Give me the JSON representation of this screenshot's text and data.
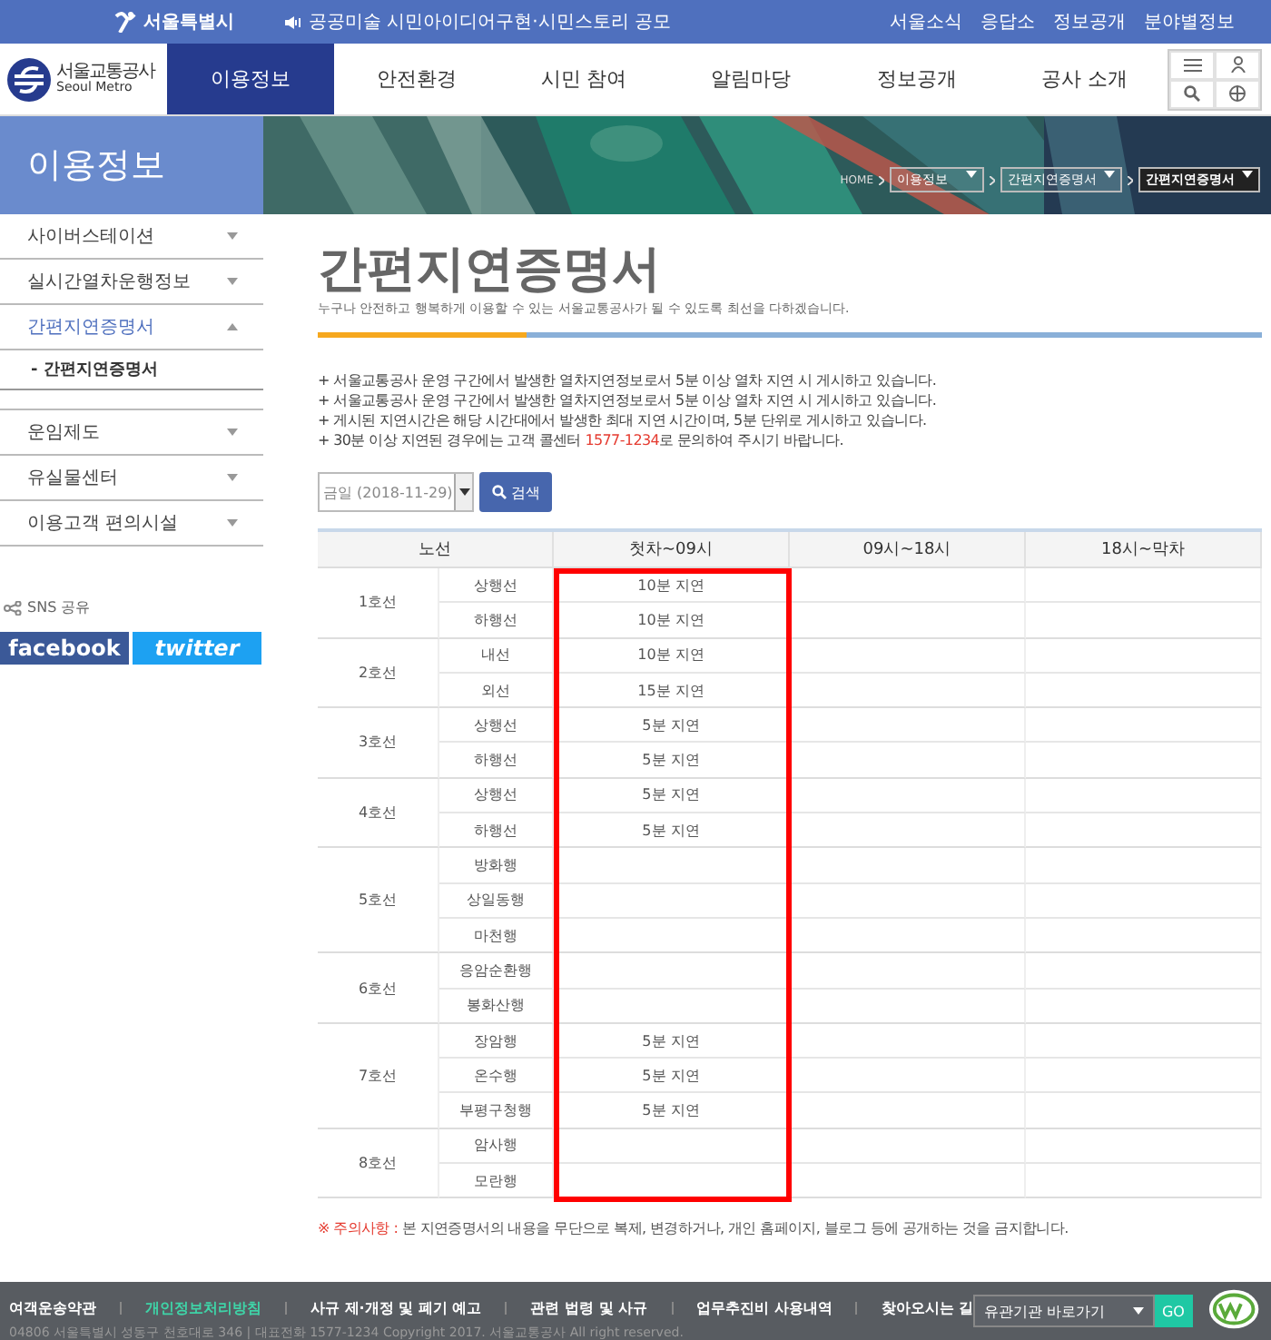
{
  "top_bar": {
    "city": "서울특별시",
    "notice": "공공미술 시민아이디어구현·시민스토리 공모",
    "links": [
      "서울소식",
      "응답소",
      "정보공개",
      "분야별정보"
    ]
  },
  "header": {
    "logo_ko": "서울교통공사",
    "logo_en": "Seoul Metro",
    "tabs": [
      {
        "label": "이용정보",
        "selected": true
      },
      {
        "label": "안전환경",
        "selected": false
      },
      {
        "label": "시민 참여",
        "selected": false
      },
      {
        "label": "알림마당",
        "selected": false
      },
      {
        "label": "정보공개",
        "selected": false
      },
      {
        "label": "공사 소개",
        "selected": false
      }
    ]
  },
  "banner": {
    "title": "이용정보",
    "home": "HOME",
    "breadcrumbs": [
      "이용정보",
      "간편지연증명서",
      "간편지연증명서"
    ]
  },
  "sidebar": {
    "items": [
      {
        "label": "사이버스테이션",
        "expanded": false,
        "selected": false
      },
      {
        "label": "실시간열차운행정보",
        "expanded": false,
        "selected": false
      },
      {
        "label": "간편지연증명서",
        "expanded": true,
        "selected": true,
        "children": [
          {
            "label": "- 간편지연증명서"
          }
        ]
      },
      {
        "label": "운임제도",
        "expanded": false,
        "selected": false
      },
      {
        "label": "유실물센터",
        "expanded": false,
        "selected": false
      },
      {
        "label": "이용고객 편의시설",
        "expanded": false,
        "selected": false
      }
    ],
    "share_label": "SNS 공유",
    "share_buttons": [
      "facebook",
      "twitter"
    ]
  },
  "page": {
    "title": "간편지연증명서",
    "subtitle": "누구나 안전하고 행복하게 이용할 수 있는 서울교통공사가 될 수 있도록 최선을 다하겠습니다.",
    "notes": [
      "+ 서울교통공사 운영 구간에서 발생한 열차지연정보로서 5분 이상 열차 지연 시 게시하고 있습니다.",
      "+ 서울교통공사 운영 구간에서 발생한 열차지연정보로서 5분 이상 열차 지연 시 게시하고 있습니다.",
      "+ 게시된 지연시간은 해당 시간대에서 발생한 최대 지연 시간이며, 5분 단위로 게시하고 있습니다.",
      "+ 30분 이상 지연된 경우에는 고객 콜센터 **1577-1234**로 문의하여 주시기 바랍니다."
    ],
    "date_select": "금일 (2018-11-29)",
    "search_button": "검색",
    "table": {
      "columns": [
        {
          "label": "노선",
          "highlighted": false
        },
        {
          "label": "첫차~09시",
          "highlighted": true
        },
        {
          "label": "09시~18시",
          "highlighted": false
        },
        {
          "label": "18시~막차",
          "highlighted": false
        }
      ],
      "lines": [
        {
          "name": "1호선",
          "directions": [
            {
              "name": "상행선",
              "delays": [
                "10분 지연"
              ]
            },
            {
              "name": "하행선",
              "delays": [
                "10분 지연"
              ]
            }
          ]
        },
        {
          "name": "2호선",
          "directions": [
            {
              "name": "내선",
              "delays": [
                "10분 지연"
              ]
            },
            {
              "name": "외선",
              "delays": [
                "15분 지연"
              ]
            }
          ]
        },
        {
          "name": "3호선",
          "directions": [
            {
              "name": "상행선",
              "delays": [
                "5분 지연"
              ]
            },
            {
              "name": "하행선",
              "delays": [
                "5분 지연"
              ]
            }
          ]
        },
        {
          "name": "4호선",
          "directions": [
            {
              "name": "상행선",
              "delays": [
                "5분 지연"
              ]
            },
            {
              "name": "하행선",
              "delays": [
                "5분 지연"
              ]
            }
          ]
        },
        {
          "name": "5호선",
          "directions": [
            {
              "name": "방화행"
            },
            {
              "name": "상일동행"
            },
            {
              "name": "마천행"
            }
          ]
        },
        {
          "name": "6호선",
          "directions": [
            {
              "name": "응암순환행"
            },
            {
              "name": "봉화산행"
            }
          ]
        },
        {
          "name": "7호선",
          "directions": [
            {
              "name": "장암행",
              "delays": [
                "5분 지연"
              ]
            },
            {
              "name": "온수행",
              "delays": [
                "5분 지연"
              ]
            },
            {
              "name": "부평구청행",
              "delays": [
                "5분 지연"
              ]
            }
          ]
        },
        {
          "name": "8호선",
          "directions": [
            {
              "name": "암사행"
            },
            {
              "name": "모란행"
            }
          ]
        }
      ]
    },
    "warning_label": "※ 주의사항 :",
    "warning": "본 지연증명서의 내용을 무단으로 복제, 변경하거나, 개인 홈페이지, 블로그 등에 공개하는 것을 금지합니다."
  },
  "footer": {
    "links": [
      {
        "label": "여객운송약관",
        "selected": false
      },
      {
        "label": "개인정보처리방침",
        "selected": true
      },
      {
        "label": "사규 제·개정 및 폐기 예고",
        "selected": false
      },
      {
        "label": "관련 법령 및 사규",
        "selected": false
      },
      {
        "label": "업무추진비 사용내역",
        "selected": false
      },
      {
        "label": "찾아오시는 길",
        "selected": false
      }
    ],
    "address": "04806 서울특별시 성동구 천호대로 346 | 대표전화 1577-1234 Copyright 2017. 서울교통공사 All right reserved.",
    "site_select": "유관기관 바로가기",
    "go_button": "GO"
  }
}
